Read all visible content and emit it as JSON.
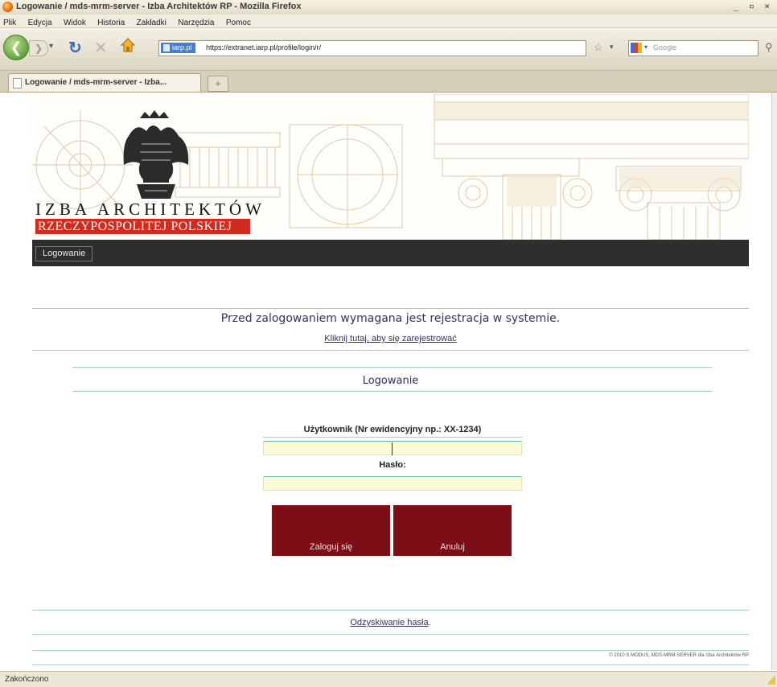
{
  "browser": {
    "window_title": "Logowanie / mds-mrm-server - Izba Architektów RP - Mozilla Firefox",
    "window_buttons": "_ ▫ ×",
    "menu": [
      "Plik",
      "Edycja",
      "Widok",
      "Historia",
      "Zakładki",
      "Narzędzia",
      "Pomoc"
    ],
    "site_badge": "iarp.pl",
    "url": "https://extranet.iarp.pl/profile/login/r/",
    "search_engine_placeholder": "Google",
    "tab_label": "Logowanie / mds-mrm-server - Izba...",
    "new_tab": "+",
    "status": "Zakończono"
  },
  "header": {
    "org_line1": "IZBA ARCHITEKTÓW",
    "org_line2": "RZECZYPOSPOLITEJ POLSKIEJ"
  },
  "site_menu": {
    "items": [
      "Logowanie"
    ]
  },
  "register": {
    "notice": "Przed zalogowaniem wymagana jest rejestracja w systemie.",
    "link": "Kliknij tutaj, aby się zarejestrować"
  },
  "login": {
    "heading": "Logowanie",
    "user_label": "Użytkownik (Nr ewidencyjny np.: XX-1234)",
    "user_value": "",
    "password_label": "Hasło:",
    "password_value": "",
    "submit_label": "Zaloguj się",
    "cancel_label": "Anuluj"
  },
  "recover": {
    "link": "Odzyskiwanie hasła",
    "suffix": "."
  },
  "footer": {
    "copyright": "© 2010 S.MODUS, MDS-MRM-SERVER dla Izba Architektów RP"
  },
  "colors": {
    "nav_bar": "#2e2e2e",
    "button": "#7c0e16",
    "input_bg": "#fdfbd7",
    "divider": "#9fd0cd",
    "heading_text": "#3c2e5e",
    "brand_red": "#d12b1f"
  }
}
